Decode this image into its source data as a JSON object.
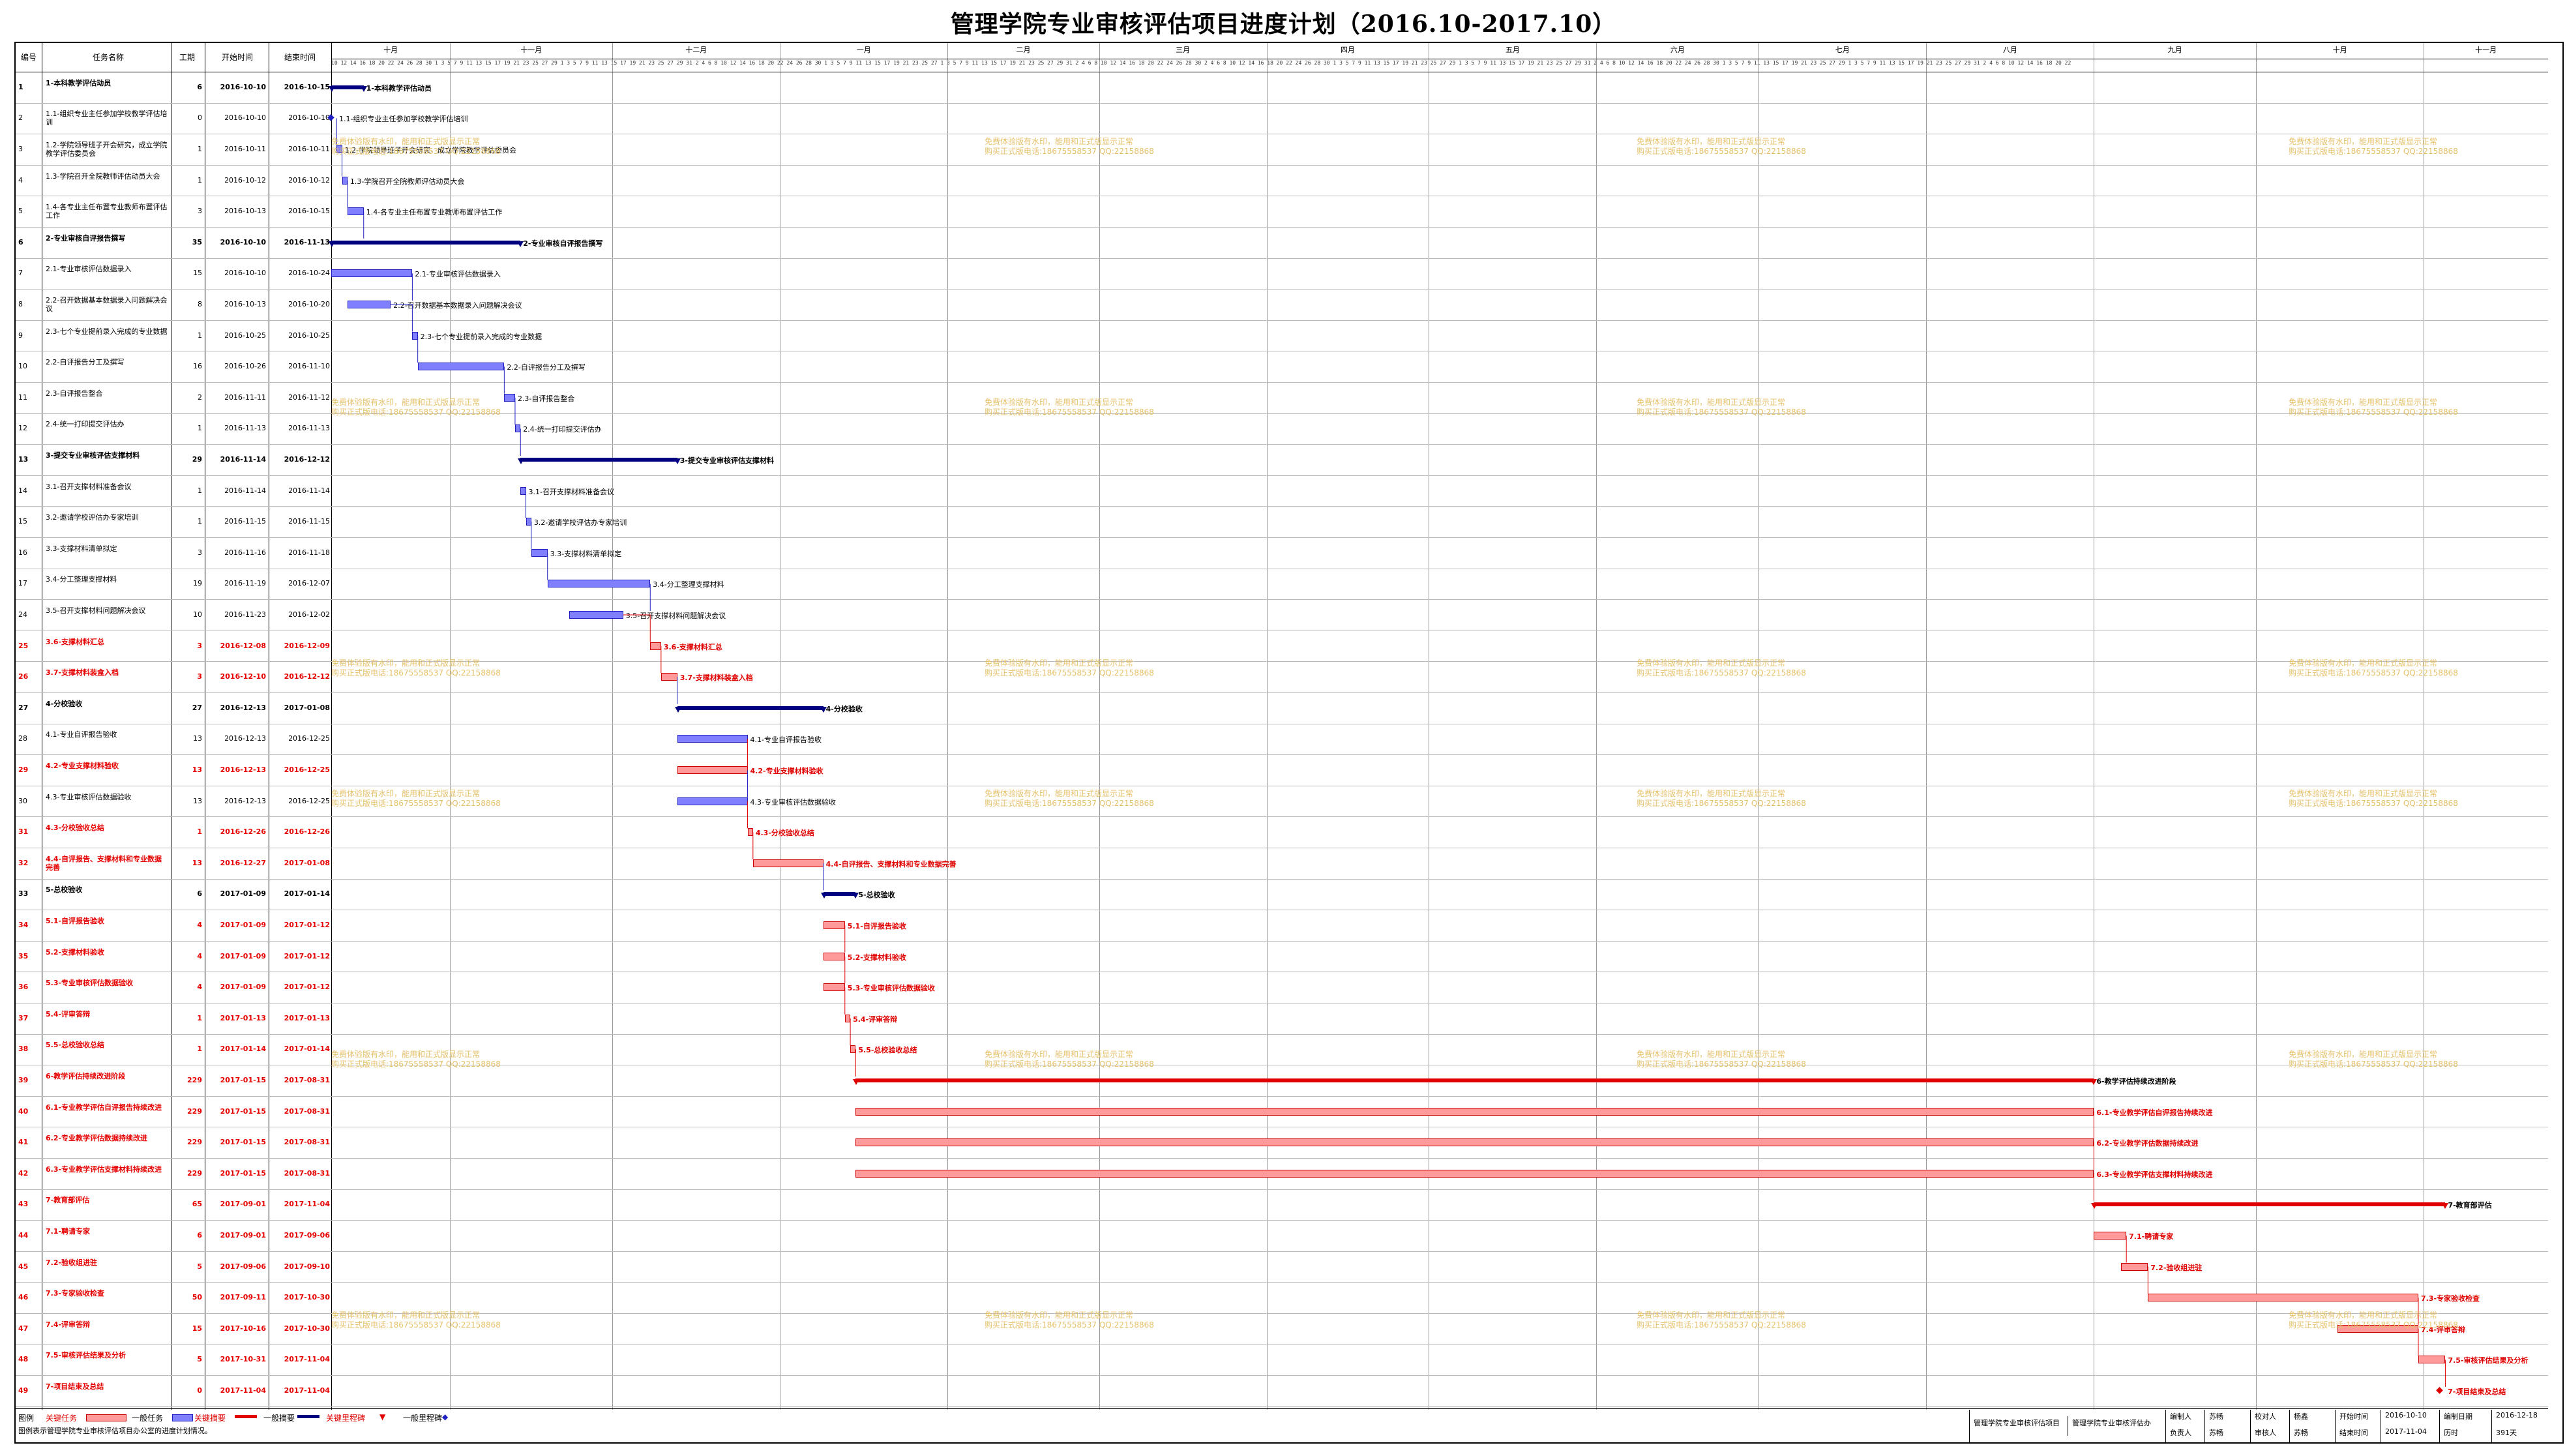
{
  "title": "管理学院专业审核评估项目进度计划（2016.10-2017.10）",
  "columns": {
    "id": "编号",
    "name": "任务名称",
    "duration": "工期",
    "start": "开始时间",
    "end": "结束时间"
  },
  "months": [
    "十月",
    "十一月",
    "十二月",
    "一月",
    "二月",
    "三月",
    "四月",
    "五月",
    "六月",
    "七月",
    "八月",
    "九月",
    "十月",
    "十一月"
  ],
  "watermark_line1": "免费体验版有水印，能用和正式版显示正常",
  "watermark_line2": "购买正式版电话:18675558537 QQ:22158868",
  "tasks": [
    {
      "id": "1",
      "name": "1-本科教学评估动员",
      "dur": "6",
      "start": "2016-10-10",
      "end": "2016-10-15",
      "level": "summary",
      "crit": false
    },
    {
      "id": "2",
      "name": "1.1-组织专业主任参加学校教学评估培训",
      "dur": "0",
      "start": "2016-10-10",
      "end": "2016-10-10",
      "level": "task",
      "crit": false
    },
    {
      "id": "3",
      "name": "1.2-学院领导班子开会研究，成立学院教学评估委员会",
      "dur": "1",
      "start": "2016-10-11",
      "end": "2016-10-11",
      "level": "task",
      "crit": false
    },
    {
      "id": "4",
      "name": "1.3-学院召开全院教师评估动员大会",
      "dur": "1",
      "start": "2016-10-12",
      "end": "2016-10-12",
      "level": "task",
      "crit": false
    },
    {
      "id": "5",
      "name": "1.4-各专业主任布置专业教师布置评估工作",
      "dur": "3",
      "start": "2016-10-13",
      "end": "2016-10-15",
      "level": "task",
      "crit": false
    },
    {
      "id": "6",
      "name": "2-专业审核自评报告撰写",
      "dur": "35",
      "start": "2016-10-10",
      "end": "2016-11-13",
      "level": "summary",
      "crit": false
    },
    {
      "id": "7",
      "name": "2.1-专业审核评估数据录入",
      "dur": "15",
      "start": "2016-10-10",
      "end": "2016-10-24",
      "level": "task",
      "crit": false
    },
    {
      "id": "8",
      "name": "2.2-召开数据基本数据录入问题解决会议",
      "dur": "8",
      "start": "2016-10-13",
      "end": "2016-10-20",
      "level": "task",
      "crit": false
    },
    {
      "id": "9",
      "name": "2.3-七个专业提前录入完成的专业数据",
      "dur": "1",
      "start": "2016-10-25",
      "end": "2016-10-25",
      "level": "task",
      "crit": false
    },
    {
      "id": "10",
      "name": "2.2-自评报告分工及撰写",
      "dur": "16",
      "start": "2016-10-26",
      "end": "2016-11-10",
      "level": "task",
      "crit": false
    },
    {
      "id": "11",
      "name": "2.3-自评报告整合",
      "dur": "2",
      "start": "2016-11-11",
      "end": "2016-11-12",
      "level": "task",
      "crit": false
    },
    {
      "id": "12",
      "name": "2.4-统一打印提交评估办",
      "dur": "1",
      "start": "2016-11-13",
      "end": "2016-11-13",
      "level": "task",
      "crit": false
    },
    {
      "id": "13",
      "name": "3-提交专业审核评估支撑材料",
      "dur": "29",
      "start": "2016-11-14",
      "end": "2016-12-12",
      "level": "summary",
      "crit": false
    },
    {
      "id": "14",
      "name": "3.1-召开支撑材料准备会议",
      "dur": "1",
      "start": "2016-11-14",
      "end": "2016-11-14",
      "level": "task",
      "crit": false
    },
    {
      "id": "15",
      "name": "3.2-邀请学校评估办专家培训",
      "dur": "1",
      "start": "2016-11-15",
      "end": "2016-11-15",
      "level": "task",
      "crit": false
    },
    {
      "id": "16",
      "name": "3.3-支撑材料清单拟定",
      "dur": "3",
      "start": "2016-11-16",
      "end": "2016-11-18",
      "level": "task",
      "crit": false
    },
    {
      "id": "17",
      "name": "3.4-分工整理支撑材料",
      "dur": "19",
      "start": "2016-11-19",
      "end": "2016-12-07",
      "level": "task",
      "crit": false
    },
    {
      "id": "24",
      "name": "3.5-召开支撑材料问题解决会议",
      "dur": "10",
      "start": "2016-11-23",
      "end": "2016-12-02",
      "level": "task",
      "crit": false
    },
    {
      "id": "25",
      "name": "3.6-支撑材料汇总",
      "dur": "3",
      "start": "2016-12-08",
      "end": "2016-12-09",
      "level": "task",
      "crit": true
    },
    {
      "id": "26",
      "name": "3.7-支撑材料装盒入档",
      "dur": "3",
      "start": "2016-12-10",
      "end": "2016-12-12",
      "level": "task",
      "crit": true
    },
    {
      "id": "27",
      "name": "4-分校验收",
      "dur": "27",
      "start": "2016-12-13",
      "end": "2017-01-08",
      "level": "summary",
      "crit": false
    },
    {
      "id": "28",
      "name": "4.1-专业自评报告验收",
      "dur": "13",
      "start": "2016-12-13",
      "end": "2016-12-25",
      "level": "task",
      "crit": false
    },
    {
      "id": "29",
      "name": "4.2-专业支撑材料验收",
      "dur": "13",
      "start": "2016-12-13",
      "end": "2016-12-25",
      "level": "task",
      "crit": true
    },
    {
      "id": "30",
      "name": "4.3-专业审核评估数据验收",
      "dur": "13",
      "start": "2016-12-13",
      "end": "2016-12-25",
      "level": "task",
      "crit": false
    },
    {
      "id": "31",
      "name": "4.3-分校验收总结",
      "dur": "1",
      "start": "2016-12-26",
      "end": "2016-12-26",
      "level": "task",
      "crit": true
    },
    {
      "id": "32",
      "name": "4.4-自评报告、支撑材料和专业数据完善",
      "dur": "13",
      "start": "2016-12-27",
      "end": "2017-01-08",
      "level": "task",
      "crit": true
    },
    {
      "id": "33",
      "name": "5-总校验收",
      "dur": "6",
      "start": "2017-01-09",
      "end": "2017-01-14",
      "level": "summary",
      "crit": false
    },
    {
      "id": "34",
      "name": "5.1-自评报告验收",
      "dur": "4",
      "start": "2017-01-09",
      "end": "2017-01-12",
      "level": "task",
      "crit": true
    },
    {
      "id": "35",
      "name": "5.2-支撑材料验收",
      "dur": "4",
      "start": "2017-01-09",
      "end": "2017-01-12",
      "level": "task",
      "crit": true
    },
    {
      "id": "36",
      "name": "5.3-专业审核评估数据验收",
      "dur": "4",
      "start": "2017-01-09",
      "end": "2017-01-12",
      "level": "task",
      "crit": true
    },
    {
      "id": "37",
      "name": "5.4-评审答辩",
      "dur": "1",
      "start": "2017-01-13",
      "end": "2017-01-13",
      "level": "task",
      "crit": true
    },
    {
      "id": "38",
      "name": "5.5-总校验收总结",
      "dur": "1",
      "start": "2017-01-14",
      "end": "2017-01-14",
      "level": "task",
      "crit": true
    },
    {
      "id": "39",
      "name": "6-教学评估持续改进阶段",
      "dur": "229",
      "start": "2017-01-15",
      "end": "2017-08-31",
      "level": "summary",
      "crit": true
    },
    {
      "id": "40",
      "name": "6.1-专业教学评估自评报告持续改进",
      "dur": "229",
      "start": "2017-01-15",
      "end": "2017-08-31",
      "level": "task",
      "crit": true
    },
    {
      "id": "41",
      "name": "6.2-专业教学评估数据持续改进",
      "dur": "229",
      "start": "2017-01-15",
      "end": "2017-08-31",
      "level": "task",
      "crit": true
    },
    {
      "id": "42",
      "name": "6.3-专业教学评估支撑材料持续改进",
      "dur": "229",
      "start": "2017-01-15",
      "end": "2017-08-31",
      "level": "task",
      "crit": true
    },
    {
      "id": "43",
      "name": "7-教育部评估",
      "dur": "65",
      "start": "2017-09-01",
      "end": "2017-11-04",
      "level": "summary",
      "crit": true
    },
    {
      "id": "44",
      "name": "7.1-聘请专家",
      "dur": "6",
      "start": "2017-09-01",
      "end": "2017-09-06",
      "level": "task",
      "crit": true
    },
    {
      "id": "45",
      "name": "7.2-验收组进驻",
      "dur": "5",
      "start": "2017-09-06",
      "end": "2017-09-10",
      "level": "task",
      "crit": true
    },
    {
      "id": "46",
      "name": "7.3-专家验收检查",
      "dur": "50",
      "start": "2017-09-11",
      "end": "2017-10-30",
      "level": "task",
      "crit": true
    },
    {
      "id": "47",
      "name": "7.4-评审答辩",
      "dur": "15",
      "start": "2017-10-16",
      "end": "2017-10-30",
      "level": "task",
      "crit": true
    },
    {
      "id": "48",
      "name": "7.5-审核评估结果及分析",
      "dur": "5",
      "start": "2017-10-31",
      "end": "2017-11-04",
      "level": "task",
      "crit": true
    },
    {
      "id": "49",
      "name": "7-项目结束及总结",
      "dur": "0",
      "start": "2017-11-04",
      "end": "2017-11-04",
      "level": "task",
      "crit": true
    }
  ],
  "legend": {
    "label": "图例",
    "crit_task": "关键任务",
    "normal_task": "一般任务",
    "crit_summary": "关键摘要",
    "normal_summary": "一般摘要",
    "crit_milestone": "关键里程碑",
    "normal_milestone": "一般里程碑",
    "note": "图例表示管理学院专业审核评估项目办公室的进度计划情况。"
  },
  "footer": {
    "proj1": "管理学院专业审核评估项目",
    "proj2": "管理学院专业审核评估办",
    "editor_label": "编制人",
    "editor": "苏畅",
    "reviewer_label": "校对人",
    "reviewer": "杨鑫",
    "start_label": "开始时间",
    "start": "2016-10-10",
    "date_label": "编制日期",
    "date": "2016-12-18",
    "owner_label": "负责人",
    "owner": "苏畅",
    "approver_label": "审核人",
    "approver": "苏畅",
    "end_label": "结束时间",
    "end": "2017-11-04",
    "total_label": "历时",
    "total": "391天"
  }
}
